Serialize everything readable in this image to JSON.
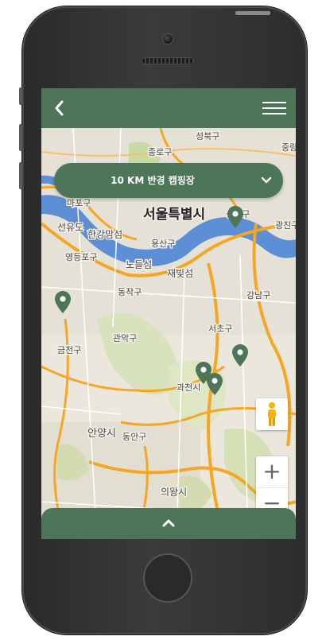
{
  "header": {
    "back_icon": "chevron-left-icon",
    "menu_icon": "hamburger-menu-icon"
  },
  "search_radius": {
    "label": "10 KM 반경 캠핑장",
    "icon": "chevron-down-icon"
  },
  "map": {
    "labels": {
      "seongbuk": "성북구",
      "jongno": "종로구",
      "jungnang": "중랑",
      "mapo": "마포구",
      "seoul": "서울특별시",
      "seongdong": "성동구",
      "gwangjin": "광진구",
      "yeouido": "선유도",
      "hanganggil": "한강맘섬",
      "yongsan": "용산구",
      "yeongdeungpo": "영등포구",
      "nodeulseom": "노들섬",
      "saebitseom": "재빛섬",
      "dongjak": "동작구",
      "gangnam": "강남구",
      "seocho": "서초구",
      "geumcheon": "금천구",
      "gwanak": "관악구",
      "gwacheon": "과천시",
      "anyang": "안양시",
      "dongan": "동안구",
      "uiwang": "의왕시"
    },
    "marker_count": 5,
    "marker_color": "#4d7558"
  },
  "controls": {
    "pegman_icon": "street-view-pegman-icon",
    "zoom_in": "+",
    "zoom_out": "−"
  },
  "bottom_panel": {
    "icon": "chevron-up-icon"
  },
  "colors": {
    "accent": "#4d7558",
    "water": "#5c8fd6",
    "highway": "#f5a623",
    "park": "#c9dba5",
    "land": "#ece7dc"
  }
}
